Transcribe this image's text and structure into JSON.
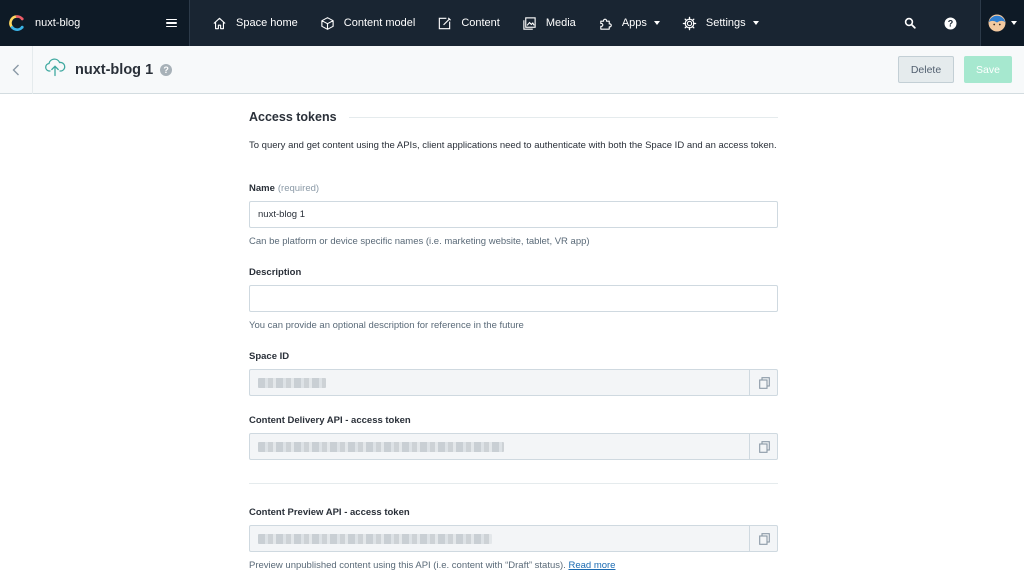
{
  "colors": {
    "topnav_bg": "#192532",
    "accent_green": "#a6e8cf",
    "link": "#1c6bb2"
  },
  "topnav": {
    "space_name": "nuxt-blog",
    "items": [
      {
        "label": "Space home",
        "icon": "home-icon"
      },
      {
        "label": "Content model",
        "icon": "cube-icon"
      },
      {
        "label": "Content",
        "icon": "edit-icon"
      },
      {
        "label": "Media",
        "icon": "image-icon"
      },
      {
        "label": "Apps",
        "icon": "puzzle-icon",
        "dropdown": true
      },
      {
        "label": "Settings",
        "icon": "gear-icon",
        "dropdown": true
      }
    ]
  },
  "subheader": {
    "title": "nuxt-blog 1",
    "help": "?",
    "delete_label": "Delete",
    "save_label": "Save"
  },
  "form": {
    "heading": "Access tokens",
    "intro": "To query and get content using the APIs, client applications need to authenticate with both the Space ID and an access token.",
    "name": {
      "label": "Name",
      "required": "(required)",
      "value": "nuxt-blog 1",
      "help": "Can be platform or device specific names (i.e. marketing website, tablet, VR app)"
    },
    "description": {
      "label": "Description",
      "value": "",
      "help": "You can provide an optional description for reference in the future"
    },
    "space_id": {
      "label": "Space ID"
    },
    "delivery": {
      "label": "Content Delivery API - access token"
    },
    "preview": {
      "label": "Content Preview API - access token",
      "help": "Preview unpublished content using this API (i.e. content with “Draft” status).",
      "link": "Read more"
    }
  }
}
